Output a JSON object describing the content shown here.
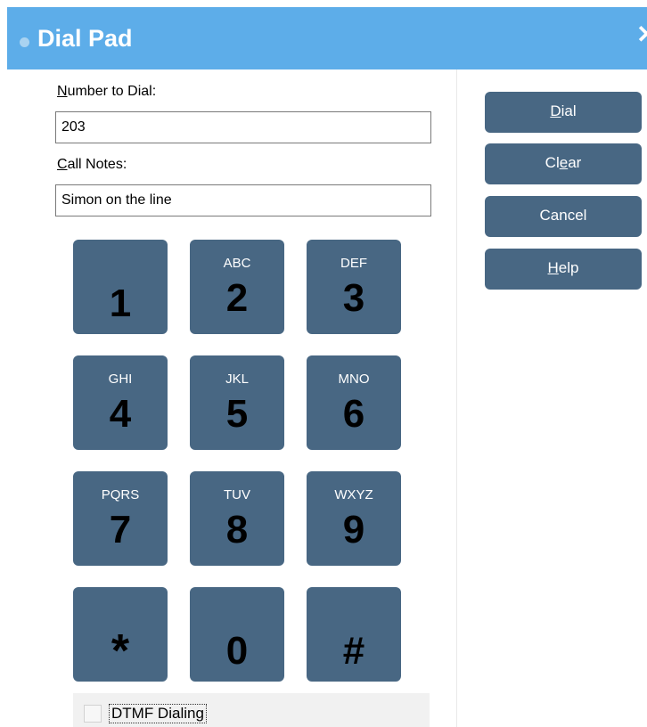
{
  "window": {
    "title": "Dial Pad",
    "close_glyph": "✕"
  },
  "form": {
    "number_label_accel": "N",
    "number_label_rest": "umber to Dial:",
    "number_value": "203",
    "notes_label_accel": "C",
    "notes_label_rest": "all Notes:",
    "notes_value": "Simon on the line"
  },
  "keypad": [
    {
      "digit": "1",
      "letters": ""
    },
    {
      "digit": "2",
      "letters": "ABC"
    },
    {
      "digit": "3",
      "letters": "DEF"
    },
    {
      "digit": "4",
      "letters": "GHI"
    },
    {
      "digit": "5",
      "letters": "JKL"
    },
    {
      "digit": "6",
      "letters": "MNO"
    },
    {
      "digit": "7",
      "letters": "PQRS"
    },
    {
      "digit": "8",
      "letters": "TUV"
    },
    {
      "digit": "9",
      "letters": "WXYZ"
    },
    {
      "digit": "*",
      "letters": ""
    },
    {
      "digit": "0",
      "letters": ""
    },
    {
      "digit": "#",
      "letters": ""
    }
  ],
  "buttons": {
    "dial_accel": "D",
    "dial_rest": "ial",
    "clear_pre": "Cl",
    "clear_accel": "e",
    "clear_rest": "ar",
    "cancel": "Cancel",
    "help_accel": "H",
    "help_rest": "elp"
  },
  "dtmf": {
    "label": "DTMF Dialing",
    "checked": false
  },
  "colors": {
    "titlebar": "#5dade9",
    "key_fill": "#486783"
  }
}
